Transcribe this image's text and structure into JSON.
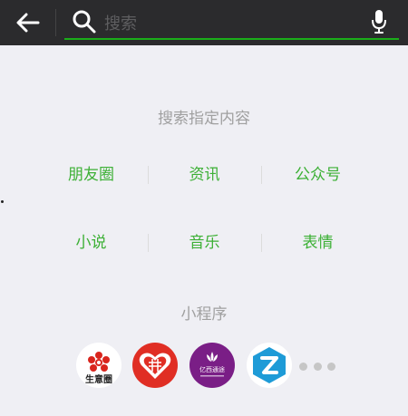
{
  "search": {
    "placeholder": "搜索",
    "value": "",
    "accent_color": "#1aad19"
  },
  "icons": {
    "back": "arrow-left-icon",
    "search": "search-icon",
    "mic": "microphone-icon"
  },
  "content_section": {
    "title": "搜索指定内容",
    "rows": [
      [
        "朋友圈",
        "资讯",
        "公众号"
      ],
      [
        "小说",
        "音乐",
        "表情"
      ]
    ],
    "link_color": "#3cb035"
  },
  "mini_programs": {
    "title": "小程序",
    "items": [
      {
        "name": "生意圈",
        "label": "生意圈",
        "color": "#ffffff"
      },
      {
        "name": "pinduoduo",
        "label": "",
        "color": "#e02e24"
      },
      {
        "name": "yixi",
        "label": "亿西通途",
        "color": "#7a1e86"
      },
      {
        "name": "z-app",
        "label": "",
        "color": "#ffffff"
      }
    ],
    "more_icon": "more-horizontal-icon"
  }
}
